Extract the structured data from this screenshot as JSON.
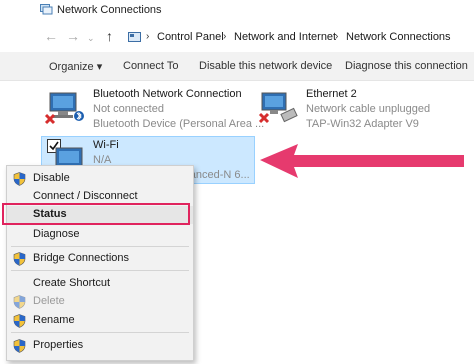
{
  "window": {
    "title": "Network Connections"
  },
  "address": {
    "crumbs": [
      "Control Panel",
      "Network and Internet",
      "Network Connections"
    ]
  },
  "toolbar": {
    "organize": "Organize ▾",
    "connect_to": "Connect To",
    "disable": "Disable this network device",
    "diagnose": "Diagnose this connection"
  },
  "adapters": [
    {
      "name": "Bluetooth Network Connection",
      "status": "Not connected",
      "device": "Bluetooth Device (Personal Area ..."
    },
    {
      "name": "Ethernet 2",
      "status": "Network cable unplugged",
      "device": "TAP-Win32 Adapter V9"
    },
    {
      "name": "Wi-Fi",
      "status": "N/A",
      "device": "...dvanced-N 6..."
    }
  ],
  "context_menu": {
    "items": [
      {
        "label": "Disable"
      },
      {
        "label": "Connect / Disconnect"
      },
      {
        "label": "Status"
      },
      {
        "label": "Diagnose"
      },
      {
        "label": "Bridge Connections"
      },
      {
        "label": "Create Shortcut"
      },
      {
        "label": "Delete"
      },
      {
        "label": "Rename"
      },
      {
        "label": "Properties"
      }
    ]
  },
  "colors": {
    "highlight_border": "#e0245e",
    "arrow": "#e63a6e",
    "selection": "#cce8ff",
    "shield_blue": "#2a67c8",
    "shield_yellow": "#f3c23a"
  },
  "icons": {
    "shield": "uac-shield-icon",
    "error_x": "red-x-icon",
    "bluetooth": "bluetooth-icon"
  }
}
